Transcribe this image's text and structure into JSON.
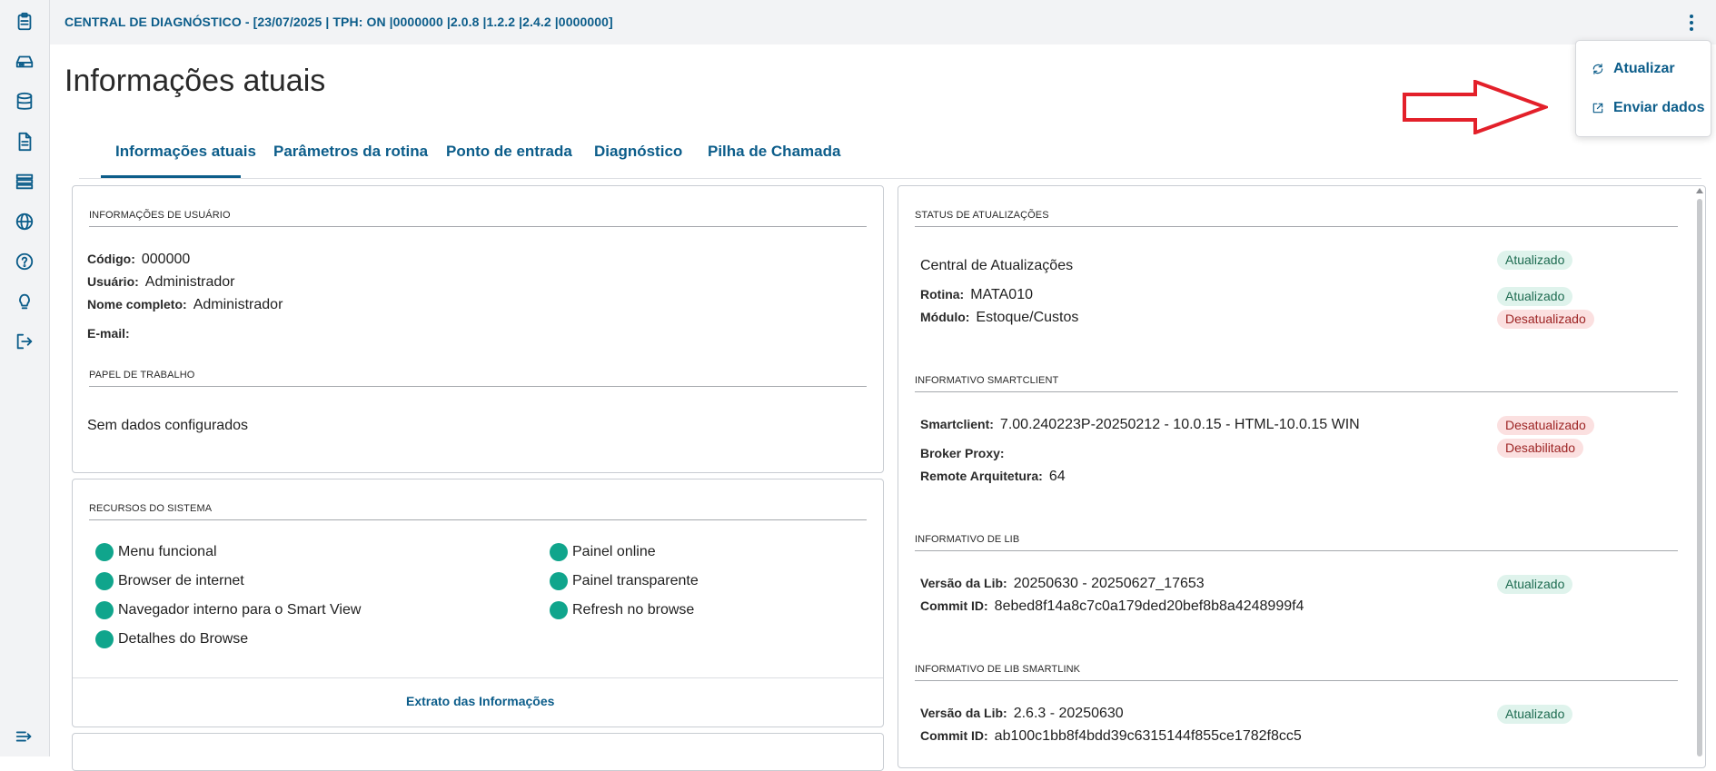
{
  "header": {
    "title": "CENTRAL DE DIAGNÓSTICO - [23/07/2025 | TPH: ON |0000000 |2.0.8 |1.2.2 |2.4.2 |0000000]"
  },
  "sidebar": {
    "icons": [
      "clipboard-icon",
      "hard-drive-icon",
      "database-icon",
      "document-icon",
      "server-icon",
      "globe-icon",
      "help-icon",
      "lightbulb-icon",
      "logout-icon"
    ],
    "bottom_icon": "collapse-menu-icon"
  },
  "page": {
    "title": "Informações atuais"
  },
  "tabs": [
    "Informações atuais",
    "Parâmetros da rotina",
    "Ponto de entrada",
    "Diagnóstico",
    "Pilha de Chamada"
  ],
  "active_tab": "Informações atuais",
  "user_info": {
    "section_label": "INFORMAÇÕES DE USUÁRIO",
    "codigo_label": "Código:",
    "codigo_value": "000000",
    "usuario_label": "Usuário:",
    "usuario_value": "Administrador",
    "nome_label": "Nome completo:",
    "nome_value": "Administrador",
    "email_label": "E-mail:",
    "email_value": ""
  },
  "papel": {
    "section_label": "PAPEL DE TRABALHO",
    "text": "Sem dados configurados"
  },
  "recursos": {
    "section_label": "RECURSOS DO SISTEMA",
    "left": [
      "Menu funcional",
      "Browser de internet",
      "Navegador interno para o Smart View",
      "Detalhes do Browse"
    ],
    "right": [
      "Painel online",
      "Painel transparente",
      "Refresh no browse"
    ],
    "status_color": "#10a58c",
    "link": "Extrato das Informações"
  },
  "status_atualizacoes": {
    "section_label": "STATUS DE ATUALIZAÇÕES",
    "central_label": "Central de Atualizações",
    "central_badge": "Atualizado",
    "rotina_label": "Rotina:",
    "rotina_value": "MATA010",
    "rotina_badge": "Atualizado",
    "modulo_label": "Módulo:",
    "modulo_value": "Estoque/Custos",
    "modulo_badge": "Desatualizado"
  },
  "smartclient": {
    "section_label": "INFORMATIVO SMARTCLIENT",
    "smartclient_label": "Smartclient:",
    "smartclient_value": "7.00.240223P-20250212 - 10.0.15 - HTML-10.0.15 WIN",
    "smartclient_badge": "Desatualizado",
    "broker_label": "Broker Proxy:",
    "broker_value": "",
    "broker_badge": "Desabilitado",
    "remote_label": "Remote Arquitetura:",
    "remote_value": "64"
  },
  "lib": {
    "section_label": "INFORMATIVO DE LIB",
    "versao_label": "Versão da Lib:",
    "versao_value": "20250630 - 20250627_17653",
    "versao_badge": "Atualizado",
    "commit_label": "Commit ID:",
    "commit_value": "8ebed8f14a8c7c0a179ded20bef8b8a4248999f4"
  },
  "lib_smartlink": {
    "section_label": "INFORMATIVO DE LIB SMARTLINK",
    "versao_label": "Versão da Lib:",
    "versao_value": "2.6.3 - 20250630",
    "versao_badge": "Atualizado",
    "commit_label": "Commit ID:",
    "commit_value": "ab100c1bb8f4bdd39c6315144f855ce1782f8cc5"
  },
  "menu": {
    "atualizar": "Atualizar",
    "enviar": "Enviar dados"
  },
  "colors": {
    "accent": "#0c5d8a",
    "badge_ok_bg": "#dff3ec",
    "badge_bad_bg": "#fbe0e0",
    "arrow": "#e3202a"
  }
}
